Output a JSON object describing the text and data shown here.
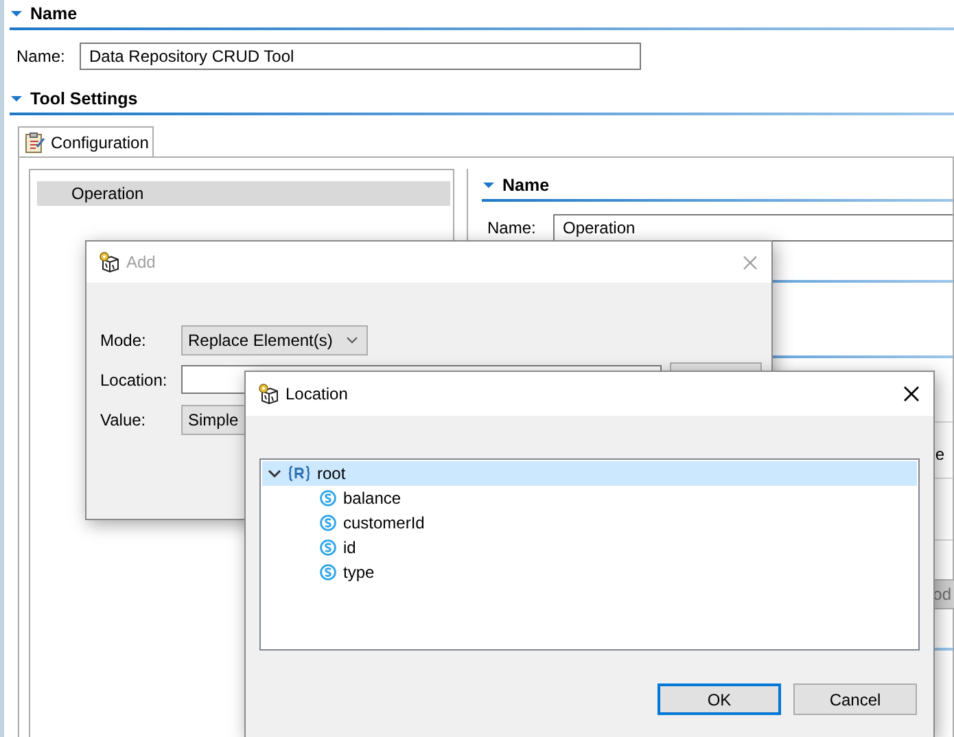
{
  "name_section": {
    "title": "Name",
    "expanded": true,
    "field_label": "Name:",
    "field_value": "Data Repository CRUD Tool"
  },
  "tool_settings": {
    "title": "Tool Settings",
    "expanded": true,
    "tabs": [
      {
        "label": "Configuration",
        "selected": true
      }
    ],
    "operations": [
      {
        "label": "Operation",
        "selected": true
      }
    ],
    "detail": {
      "title": "Name",
      "expanded": true,
      "field_label": "Name:",
      "field_value": "Operation",
      "partial_label": "e",
      "partial_button": "od"
    }
  },
  "add_dialog": {
    "title": "Add",
    "active": false,
    "fields": [
      {
        "kind": "dropdown",
        "label": "Mode:",
        "value": "Replace Element(s)"
      },
      {
        "kind": "browse",
        "label": "Location:"
      },
      {
        "kind": "dropdown",
        "label": "Value:",
        "value": "Simple"
      }
    ]
  },
  "location_dialog": {
    "title": "Location",
    "active": true,
    "tree": [
      {
        "label": "root",
        "kind": "record",
        "expanded": true,
        "selected": true,
        "children": [
          {
            "label": "balance",
            "kind": "string",
            "selected": false
          },
          {
            "label": "customerId",
            "kind": "string",
            "selected": false
          },
          {
            "label": "id",
            "kind": "string",
            "selected": false
          },
          {
            "label": "type",
            "kind": "string",
            "selected": false
          }
        ]
      }
    ],
    "buttons": [
      {
        "label": "OK",
        "default": true
      },
      {
        "label": "Cancel",
        "default": false
      }
    ]
  }
}
